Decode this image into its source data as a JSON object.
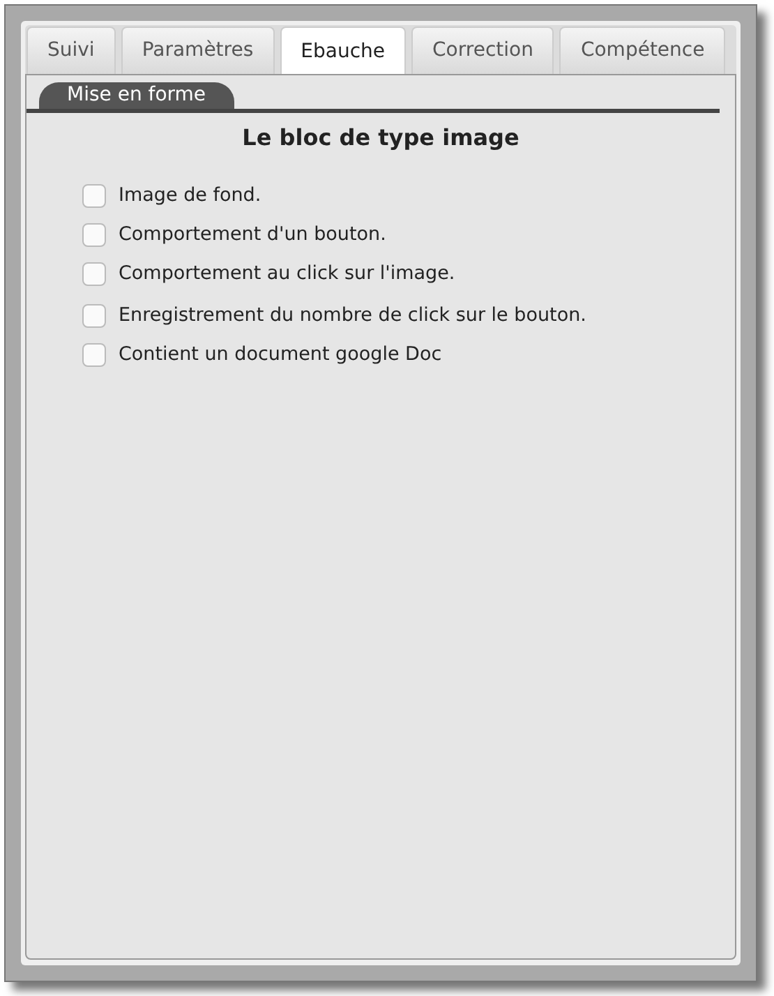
{
  "tabs": [
    {
      "label": "Suivi",
      "selected": false
    },
    {
      "label": "Paramètres",
      "selected": false
    },
    {
      "label": "Ebauche",
      "selected": true
    },
    {
      "label": "Correction",
      "selected": false
    },
    {
      "label": "Compétence",
      "selected": false
    }
  ],
  "section_tab": "Mise en forme",
  "title": "Le bloc de type image",
  "option_groups": [
    [
      {
        "label": "Image de fond.",
        "checked": false
      },
      {
        "label": "Comportement d'un bouton.",
        "checked": false
      },
      {
        "label": "Comportement au click sur l'image.",
        "checked": false
      }
    ],
    [
      {
        "label": "Enregistrement du nombre de click sur le bouton.",
        "checked": false
      },
      {
        "label": "Contient un document google Doc",
        "checked": false
      }
    ]
  ]
}
